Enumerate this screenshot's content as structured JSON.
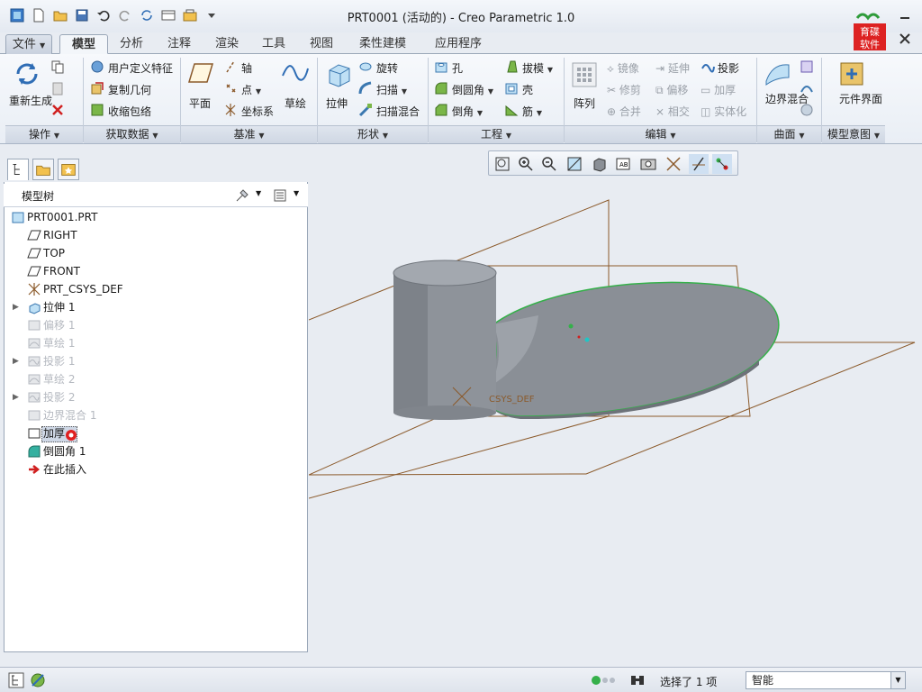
{
  "window": {
    "title": "PRT0001 (活动的) - Creo Parametric 1.0",
    "brand_text": "育碟软件"
  },
  "tabs": [
    "文件",
    "模型",
    "分析",
    "注释",
    "渲染",
    "工具",
    "视图",
    "柔性建模",
    "应用程序"
  ],
  "ribbon": {
    "operations": {
      "regenerate": "重新生成",
      "group": "操作"
    },
    "get_data": {
      "udf": "用户定义特征",
      "copy_geom": "复制几何",
      "shrinkwrap": "收缩包络",
      "group": "获取数据"
    },
    "datum": {
      "plane": "平面",
      "axis": "轴",
      "point": "点",
      "csys": "坐标系",
      "sketch": "草绘",
      "group": "基准"
    },
    "shapes": {
      "extrude": "拉伸",
      "revolve": "旋转",
      "sweep": "扫描",
      "swept_blend": "扫描混合",
      "group": "形状"
    },
    "engineering": {
      "hole": "孔",
      "round": "倒圆角",
      "chamfer": "倒角",
      "draft": "拔模",
      "shell": "壳",
      "rib": "筋",
      "group": "工程"
    },
    "editing": {
      "pattern": "阵列",
      "mirror": "镜像",
      "trim": "修剪",
      "merge": "合并",
      "extend": "延伸",
      "offset": "偏移",
      "intersect": "相交",
      "project": "投影",
      "thicken": "加厚",
      "solidify": "实体化",
      "group": "编辑"
    },
    "surfaces": {
      "boundary_blend": "边界混合",
      "group": "曲面"
    },
    "model_intent": {
      "component_interface": "元件界面",
      "group": "模型意图"
    }
  },
  "model_tree": {
    "title": "模型树",
    "items": [
      {
        "label": "PRT0001.PRT",
        "icon": "part-icon",
        "disabled": false,
        "expandable": false
      },
      {
        "label": "RIGHT",
        "icon": "datum-plane-icon",
        "disabled": false,
        "expandable": false
      },
      {
        "label": "TOP",
        "icon": "datum-plane-icon",
        "disabled": false,
        "expandable": false
      },
      {
        "label": "FRONT",
        "icon": "datum-plane-icon",
        "disabled": false,
        "expandable": false
      },
      {
        "label": "PRT_CSYS_DEF",
        "icon": "csys-icon",
        "disabled": false,
        "expandable": false
      },
      {
        "label": "拉伸 1",
        "icon": "extrude-icon",
        "disabled": false,
        "expandable": true
      },
      {
        "label": "偏移 1",
        "icon": "offset-icon",
        "disabled": true,
        "expandable": false
      },
      {
        "label": "草绘 1",
        "icon": "sketch-icon",
        "disabled": true,
        "expandable": false
      },
      {
        "label": "投影 1",
        "icon": "project-icon",
        "disabled": true,
        "expandable": true
      },
      {
        "label": "草绘 2",
        "icon": "sketch-icon",
        "disabled": true,
        "expandable": false
      },
      {
        "label": "投影 2",
        "icon": "project-icon",
        "disabled": true,
        "expandable": true
      },
      {
        "label": "边界混合 1",
        "icon": "boundary-blend-icon",
        "disabled": true,
        "expandable": false
      },
      {
        "label": "加厚",
        "icon": "thicken-icon",
        "disabled": false,
        "expandable": false
      },
      {
        "label": "倒圆角 1",
        "icon": "round-icon",
        "disabled": false,
        "expandable": false
      },
      {
        "label": "在此插入",
        "icon": "insert-here-icon",
        "disabled": false,
        "expandable": false
      }
    ]
  },
  "graphics": {
    "csys_label": "CSYS_DEF"
  },
  "status": {
    "selected_text": "选择了 1 项",
    "filter_value": "智能"
  },
  "colors": {
    "accent": "#2f6db5",
    "model_gray": "#8a8f96",
    "datum_brown": "#8b5a2b",
    "edge_green": "#35b04a"
  }
}
